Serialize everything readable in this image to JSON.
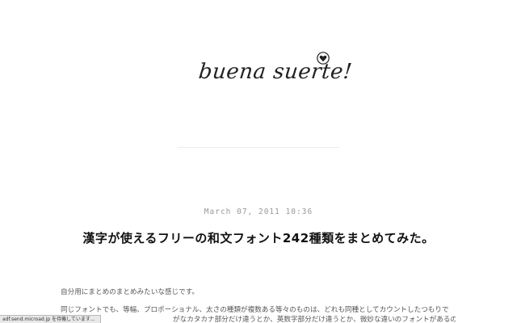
{
  "blog": {
    "title": "buena suerte!"
  },
  "post": {
    "date": "March 07, 2011 10:36",
    "title": "漢字が使えるフリーの和文フォント242種類をまとめてみた。",
    "paragraphs": [
      "自分用にまとめのまとめみたいな感じです。",
      "同じフォントでも、等幅、プロポーショナル、太さの種類が複数ある等々のものは、どれも同種としてカウントしたつもりで",
      "がなカタカナ部分だけ違うとか、英数字部分だけ違うとか、微妙な違いのフォントがあるの"
    ]
  },
  "status_bar": {
    "text": "adf.send.microad.jp を待機しています..."
  },
  "icons": {
    "logo_badge": "heart-icon"
  }
}
